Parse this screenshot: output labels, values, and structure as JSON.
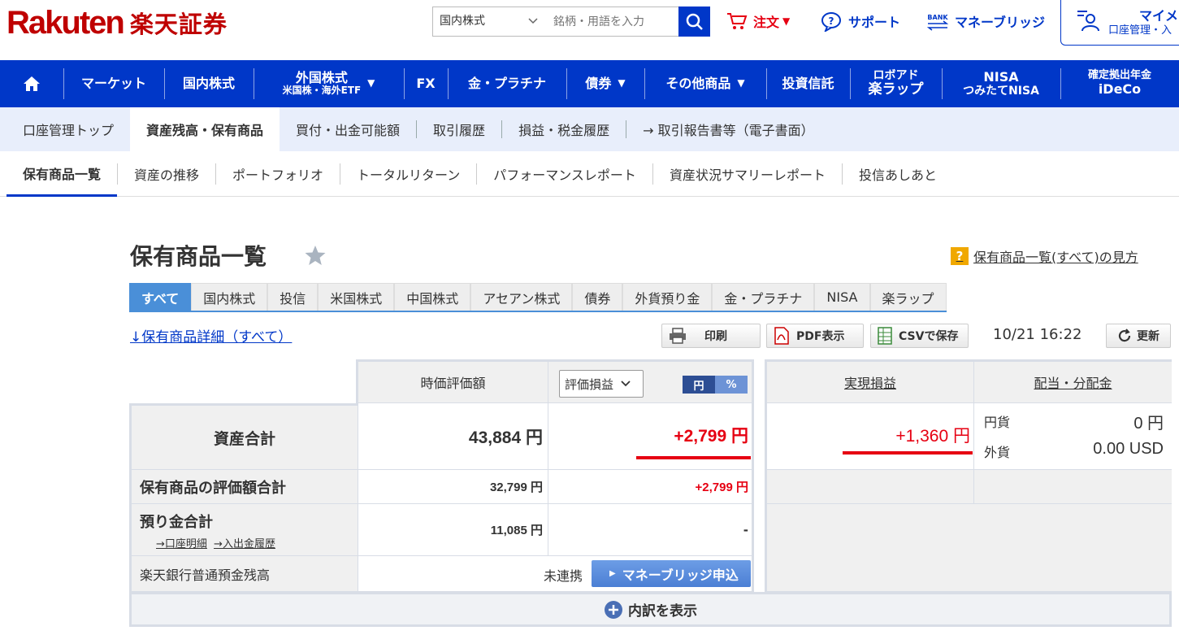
{
  "header": {
    "logo_en": "Rakuten",
    "logo_jp": "楽天証券",
    "search_select": "国内株式",
    "search_placeholder": "銘柄・用語を入力",
    "order": "注文",
    "support": "サポート",
    "bank_icon": "BANK",
    "moneybridge": "マネーブリッジ",
    "mypage_title": "マイメ",
    "mypage_sub": "口座管理・入"
  },
  "global_nav": [
    "マーケット",
    "国内株式",
    "外国株式",
    "米国株・海外ETF",
    "FX",
    "金・プラチナ",
    "債券",
    "その他商品",
    "投資信託",
    "ロボアド",
    "楽ラップ",
    "NISA",
    "つみたてNISA",
    "確定拠出年金",
    "iDeCo"
  ],
  "sub_nav": [
    "口座管理トップ",
    "資産残高・保有商品",
    "買付・出金可能額",
    "取引履歴",
    "損益・税金履歴",
    "→ 取引報告書等（電子書面）"
  ],
  "tab_nav": [
    "保有商品一覧",
    "資産の推移",
    "ポートフォリオ",
    "トータルリターン",
    "パフォーマンスレポート",
    "資産状況サマリーレポート",
    "投信あしあと"
  ],
  "page": {
    "title": "保有商品一覧",
    "help": "保有商品一覧(すべて)の見方",
    "help_mark": "?"
  },
  "product_tabs": [
    "すべて",
    "国内株式",
    "投信",
    "米国株式",
    "中国株式",
    "アセアン株式",
    "債券",
    "外貨預り金",
    "金・プラチナ",
    "NISA",
    "楽ラップ"
  ],
  "toolbar": {
    "detail_link": "↓保有商品詳細（すべて）",
    "print": "印刷",
    "pdf": "PDF表示",
    "csv": "CSVで保存",
    "timestamp": "10/21 16:22",
    "refresh": "更新"
  },
  "table": {
    "col_market_value": "時価評価額",
    "dropdown": "評価損益",
    "toggle_yen": "円",
    "toggle_pct": "%",
    "col_realized": "実現損益",
    "col_dividend": "配当・分配金",
    "total_label": "資産合計",
    "total_value": "43,884 円",
    "total_pl": "+2,799 円",
    "realized_value": "+1,360 円",
    "div_yen_label": "円貨",
    "div_yen_value": "0 円",
    "div_fx_label": "外貨",
    "div_fx_value": "0.00 USD",
    "holdings_label": "保有商品の評価額合計",
    "holdings_value": "32,799 円",
    "holdings_pl": "+2,799 円",
    "deposit_label": "預り金合計",
    "deposit_link1": "→口座明細",
    "deposit_link2": "→入出金履歴",
    "deposit_value": "11,085 円",
    "deposit_pl": "-",
    "bank_label": "楽天銀行普通預金残高",
    "bank_status": "未連携",
    "bank_button": "マネーブリッジ申込",
    "expand": "内訳を表示"
  },
  "colors": {
    "brand_red": "#bf0000",
    "nav_blue": "#0037c8",
    "profit_red": "#e60012",
    "tab_blue": "#4a8fd8"
  }
}
